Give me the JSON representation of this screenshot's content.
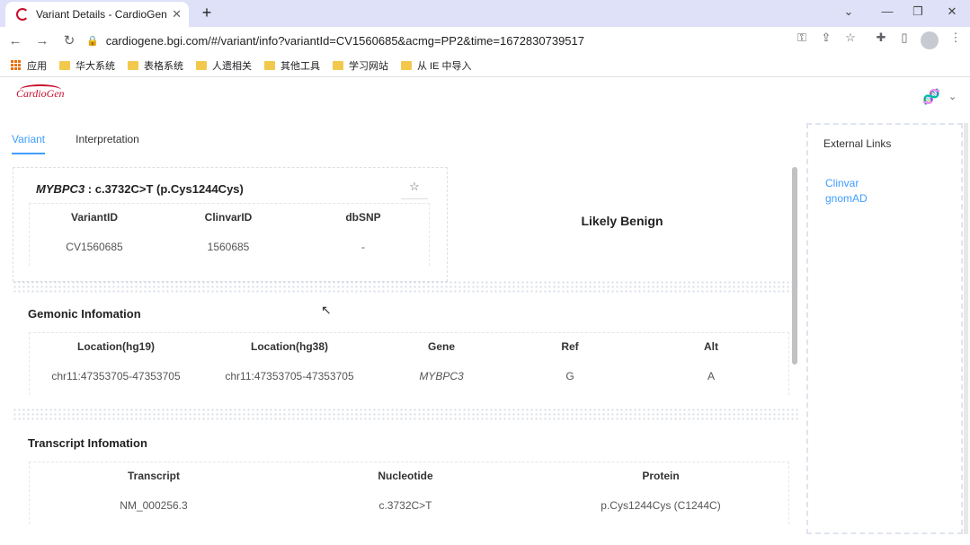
{
  "browser": {
    "tab_title": "Variant Details - CardioGen",
    "tab_close": "✕",
    "new_tab": "+",
    "url": "cardiogene.bgi.com/#/variant/info?variantId=CV1560685&acmg=PP2&time=1672830739517",
    "window_controls": [
      "⌄",
      "—",
      "❐",
      "✕"
    ],
    "nav": [
      "←",
      "→",
      "↻"
    ],
    "toolbar_icons": [
      "key-icon",
      "share-icon",
      "star-icon",
      "extensions-icon",
      "sidebar-icon"
    ]
  },
  "bookmarks": [
    {
      "label": "应用",
      "icon": "apps-icon"
    },
    {
      "label": "华大系统",
      "icon": "folder-icon"
    },
    {
      "label": "表格系统",
      "icon": "folder-icon"
    },
    {
      "label": "人遗相关",
      "icon": "folder-icon"
    },
    {
      "label": "其他工具",
      "icon": "folder-icon"
    },
    {
      "label": "学习网站",
      "icon": "folder-icon"
    },
    {
      "label": "从 IE 中导入",
      "icon": "folder-icon"
    }
  ],
  "app": {
    "logo_text": "CardioGen",
    "tabs": [
      {
        "label": "Variant",
        "active": true
      },
      {
        "label": "Interpretation",
        "active": false
      }
    ]
  },
  "variant": {
    "gene": "MYBPC3",
    "change": " : c.3732C>T (p.Cys1244Cys)",
    "classification": "Likely Benign",
    "headers": [
      "VariantID",
      "ClinvarID",
      "dbSNP"
    ],
    "values": [
      "CV1560685",
      "1560685",
      "-"
    ]
  },
  "genomic": {
    "title": "Gemonic Infomation",
    "headers": [
      "Location(hg19)",
      "Location(hg38)",
      "Gene",
      "Ref",
      "Alt"
    ],
    "values": [
      "chr11:47353705-47353705",
      "chr11:47353705-47353705",
      "MYBPC3",
      "G",
      "A"
    ]
  },
  "transcript": {
    "title": "Transcript Infomation",
    "headers": [
      "Transcript",
      "Nucleotide",
      "Protein"
    ],
    "values": [
      "NM_000256.3",
      "c.3732C>T",
      "p.Cys1244Cys (C1244C)"
    ]
  },
  "external_links": {
    "title": "External Links",
    "links": [
      "Clinvar",
      "gnomAD"
    ]
  },
  "colors": {
    "accent": "#409eff",
    "brand": "#c8102e"
  }
}
